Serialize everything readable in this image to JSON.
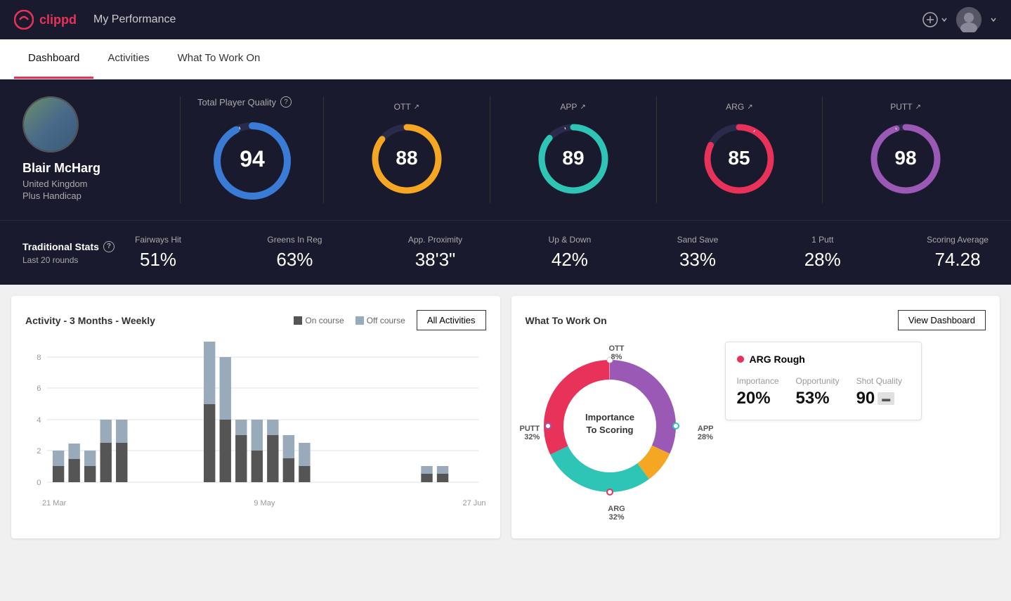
{
  "app": {
    "logo": "clippd",
    "nav_title": "My Performance"
  },
  "tabs": [
    {
      "label": "Dashboard",
      "active": true
    },
    {
      "label": "Activities",
      "active": false
    },
    {
      "label": "What To Work On",
      "active": false
    }
  ],
  "profile": {
    "name": "Blair McHarg",
    "country": "United Kingdom",
    "handicap": "Plus Handicap"
  },
  "total_quality": {
    "label": "Total Player Quality",
    "value": 94,
    "color": "#3a7bd5"
  },
  "categories": [
    {
      "label": "OTT",
      "value": 88,
      "color": "#f5a623"
    },
    {
      "label": "APP",
      "value": 89,
      "color": "#2ec4b6"
    },
    {
      "label": "ARG",
      "value": 85,
      "color": "#e8325a"
    },
    {
      "label": "PUTT",
      "value": 98,
      "color": "#9b59b6"
    }
  ],
  "traditional_stats": {
    "title": "Traditional Stats",
    "subtitle": "Last 20 rounds",
    "items": [
      {
        "label": "Fairways Hit",
        "value": "51%"
      },
      {
        "label": "Greens In Reg",
        "value": "63%"
      },
      {
        "label": "App. Proximity",
        "value": "38'3\""
      },
      {
        "label": "Up & Down",
        "value": "42%"
      },
      {
        "label": "Sand Save",
        "value": "33%"
      },
      {
        "label": "1 Putt",
        "value": "28%"
      },
      {
        "label": "Scoring Average",
        "value": "74.28"
      }
    ]
  },
  "activity_chart": {
    "title": "Activity - 3 Months - Weekly",
    "legend": [
      {
        "label": "On course",
        "color": "#555"
      },
      {
        "label": "Off course",
        "color": "#9ab"
      }
    ],
    "all_activities_label": "All Activities",
    "x_labels": [
      "21 Mar",
      "9 May",
      "27 Jun"
    ],
    "bars": [
      {
        "on": 1,
        "off": 1
      },
      {
        "on": 1.5,
        "off": 1
      },
      {
        "on": 1,
        "off": 1
      },
      {
        "on": 2.5,
        "off": 1.5
      },
      {
        "on": 2.5,
        "off": 1.5
      },
      {
        "on": 4,
        "off": 5
      },
      {
        "on": 4,
        "off": 4
      },
      {
        "on": 3,
        "off": 1
      },
      {
        "on": 2,
        "off": 2
      },
      {
        "on": 3,
        "off": 1
      },
      {
        "on": 1.5,
        "off": 1.5
      },
      {
        "on": 1,
        "off": 1.5
      },
      {
        "on": 0.5,
        "off": 0.5
      },
      {
        "on": 0.5,
        "off": 0.5
      }
    ],
    "y_max": 9,
    "y_labels": [
      "0",
      "2",
      "4",
      "6",
      "8"
    ]
  },
  "wtwo": {
    "title": "What To Work On",
    "view_dashboard_label": "View Dashboard",
    "donut_center": "Importance\nTo Scoring",
    "segments": [
      {
        "label": "OTT",
        "pct": "8%",
        "color": "#f5a623",
        "position": "top"
      },
      {
        "label": "APP",
        "pct": "28%",
        "color": "#2ec4b6",
        "position": "right"
      },
      {
        "label": "ARG",
        "pct": "32%",
        "color": "#e8325a",
        "position": "bottom"
      },
      {
        "label": "PUTT",
        "pct": "32%",
        "color": "#9b59b6",
        "position": "left"
      }
    ],
    "card": {
      "title": "ARG Rough",
      "dot_color": "#e8325a",
      "metrics": [
        {
          "label": "Importance",
          "value": "20%"
        },
        {
          "label": "Opportunity",
          "value": "53%"
        },
        {
          "label": "Shot Quality",
          "value": "90",
          "badge": true
        }
      ]
    }
  }
}
